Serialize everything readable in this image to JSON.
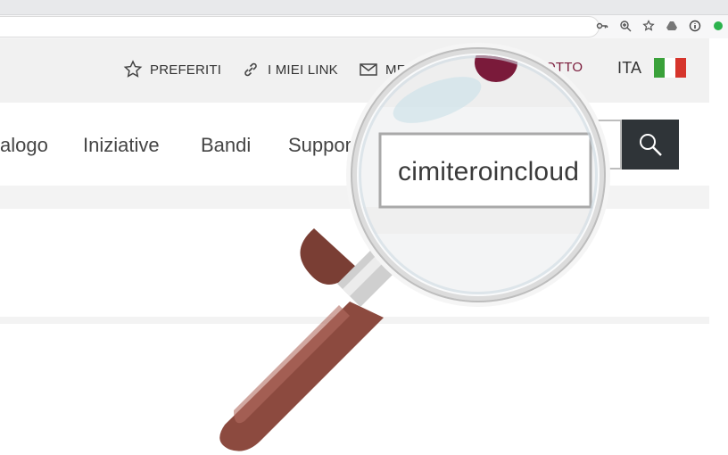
{
  "utility": {
    "favorites": "PREFERITI",
    "my_links": "I MIEI LINK",
    "messages": "ME",
    "cart": "COTTO",
    "language": "ITA"
  },
  "nav": {
    "items": [
      "alogo",
      "Iniziative",
      "Bandi",
      "Suppor"
    ]
  },
  "search": {
    "query": "cimiteroincloud"
  },
  "colors": {
    "accent": "#7a1a3a",
    "search_button": "#2f3438",
    "flag_green": "#3aa13a",
    "flag_red": "#d6352c"
  },
  "icons": [
    "key-icon",
    "zoom-icon",
    "star-icon",
    "drive-icon",
    "info-icon",
    "extension-icon",
    "search-icon",
    "link-icon",
    "mail-icon"
  ]
}
